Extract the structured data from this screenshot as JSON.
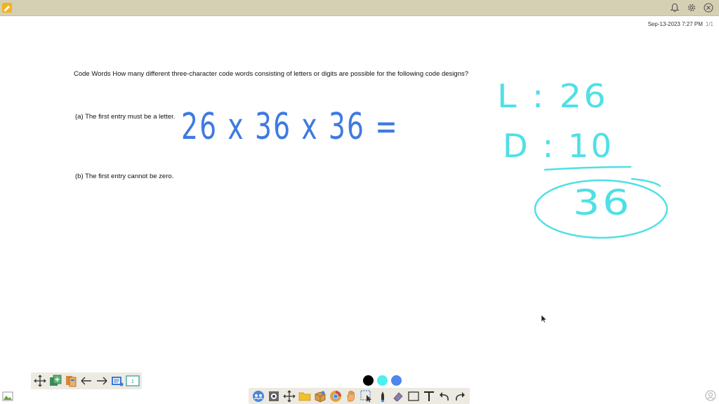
{
  "header": {
    "icons": [
      "pencil-icon",
      "bell-icon",
      "gear-icon",
      "close-icon"
    ]
  },
  "meta": {
    "timestamp": "Sep-13-2023 7:27 PM",
    "page": "1/1"
  },
  "document": {
    "problem": "Code Words How many different three-character code words consisting of letters or digits are possible for the following code designs?",
    "part_a": "(a) The first entry must be a letter.",
    "part_b": "(b) The first entry cannot be zero."
  },
  "handwriting": {
    "equation": "26 x 36 x 36 =",
    "letters_line": "L : 26",
    "digits_line": "D : 10",
    "total": "36"
  },
  "colors": {
    "ink_blue": "#3f7ae0",
    "ink_cyan": "#4fe0e6",
    "swatch_black": "#000000",
    "swatch_cyan": "#4df0f0",
    "swatch_blue": "#4f86ec"
  },
  "left_toolbar": [
    "move-icon",
    "add-page-icon",
    "pages-icon",
    "arrow-left-icon",
    "arrow-right-icon",
    "page-settings-icon",
    "page-number-icon"
  ],
  "page_number_label": "1",
  "bottom_toolbar": [
    "users-icon",
    "camera-icon",
    "move-icon",
    "folder-icon",
    "box-icon",
    "browser-icon",
    "hand-icon",
    "select-icon",
    "pen-icon",
    "eraser-icon",
    "rectangle-icon",
    "text-icon",
    "undo-icon",
    "redo-icon"
  ]
}
